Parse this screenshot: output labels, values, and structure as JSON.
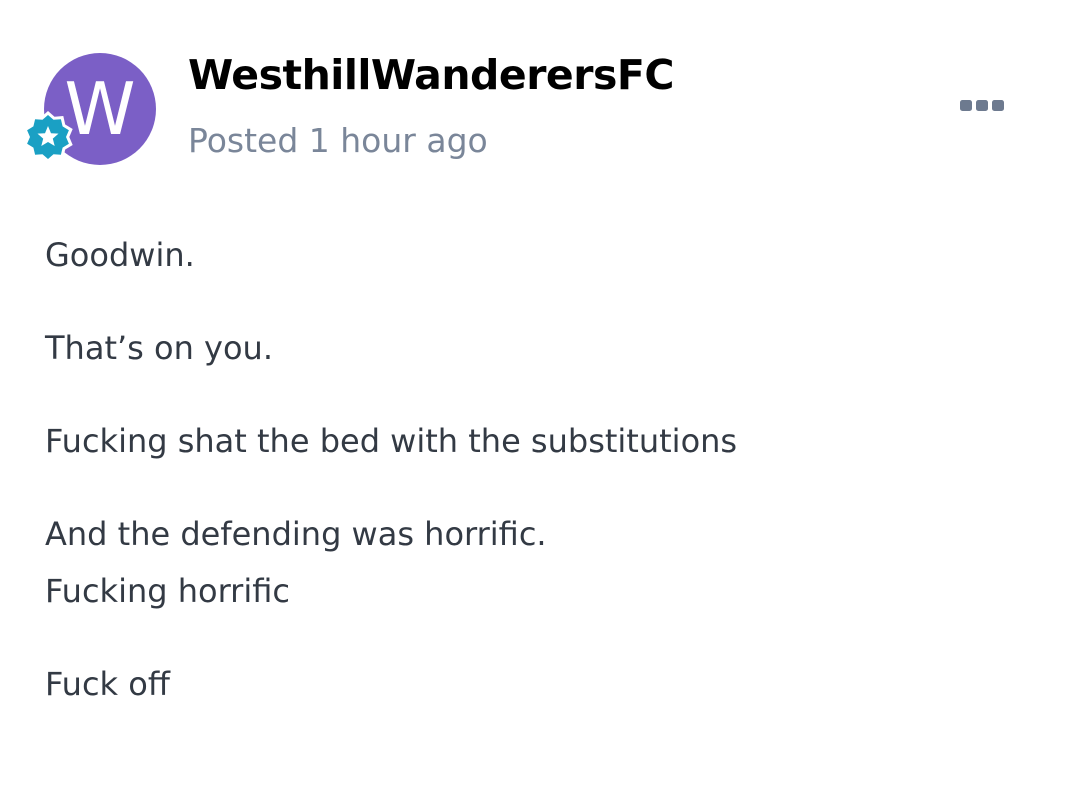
{
  "post": {
    "author": {
      "avatar_letter": "W",
      "avatar_color": "#7b5fc6",
      "name": "WesthillWanderersFC",
      "badge_icon": "star-badge-icon",
      "badge_color": "#1aa0c4"
    },
    "timestamp": "Posted 1 hour ago",
    "more_icon": "more-options-icon",
    "paragraphs": [
      [
        "Goodwin."
      ],
      [
        "That’s on you."
      ],
      [
        "Fucking shat the bed with the substitutions"
      ],
      [
        "And the defending was horrific.",
        "Fucking horrific"
      ],
      [
        "Fuck off"
      ]
    ]
  }
}
